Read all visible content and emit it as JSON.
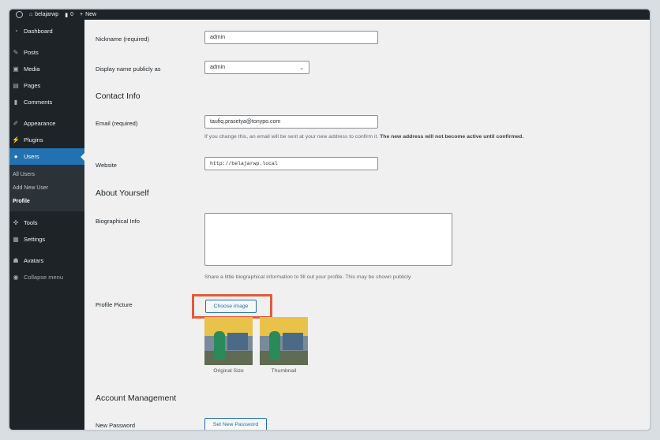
{
  "adminbar": {
    "site_name": "belajarwp",
    "comments_count": "0",
    "new_label": "New"
  },
  "sidebar": {
    "items": [
      {
        "label": "Dashboard",
        "icon": "dashboard-icon"
      },
      {
        "label": "Posts",
        "icon": "pin-icon"
      },
      {
        "label": "Media",
        "icon": "media-icon"
      },
      {
        "label": "Pages",
        "icon": "page-icon"
      },
      {
        "label": "Comments",
        "icon": "comment-icon"
      },
      {
        "label": "Appearance",
        "icon": "brush-icon"
      },
      {
        "label": "Plugins",
        "icon": "plug-icon"
      },
      {
        "label": "Users",
        "icon": "user-icon"
      },
      {
        "label": "Tools",
        "icon": "wrench-icon"
      },
      {
        "label": "Settings",
        "icon": "settings-icon"
      },
      {
        "label": "Avatars",
        "icon": "avatars-icon"
      },
      {
        "label": "Collapse menu",
        "icon": "collapse-icon"
      }
    ],
    "users_submenu": [
      "All Users",
      "Add New User",
      "Profile"
    ]
  },
  "form": {
    "nickname_label": "Nickname (required)",
    "nickname_value": "admin",
    "display_name_label": "Display name publicly as",
    "display_name_value": "admin",
    "contact_info_title": "Contact Info",
    "email_label": "Email (required)",
    "email_value": "taufiq.prasetya@tonypo.com",
    "email_desc_normal": "If you change this, an email will be sent at your new address to confirm it.",
    "email_desc_bold": "The new address will not become active until confirmed.",
    "website_label": "Website",
    "website_value": "http://belajarwp.local",
    "about_title": "About Yourself",
    "bio_label": "Biographical Info",
    "bio_value": "",
    "bio_desc": "Share a little biographical information to fill out your profile. This may be shown publicly.",
    "profile_picture_label": "Profile Picture",
    "choose_image_label": "Choose image",
    "original_size_caption": "Original Size",
    "thumbnail_caption": "Thumbnail",
    "account_title": "Account Management",
    "new_password_label": "New Password",
    "set_password_label": "Set New Password"
  },
  "colors": {
    "accent": "#2271b1",
    "highlight": "#e35a3b",
    "sidebar_bg": "#1d2327"
  }
}
